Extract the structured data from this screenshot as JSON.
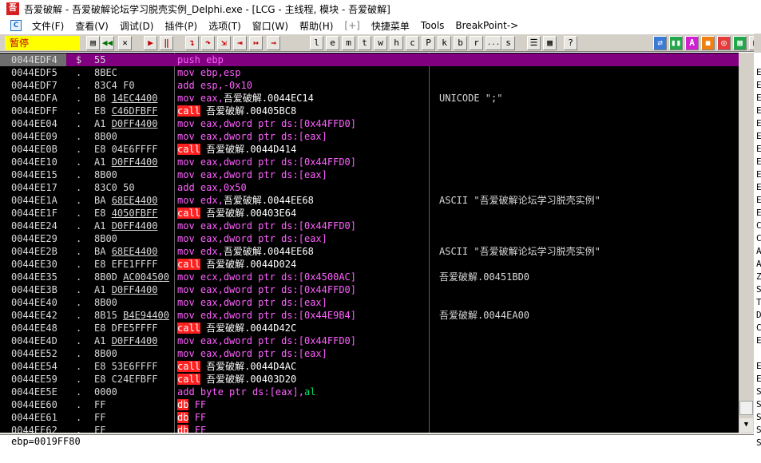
{
  "window": {
    "icon_text": "吾",
    "title": "吾爱破解 - 吾爱破解论坛学习脱壳实例_Delphi.exe - [LCG - 主线程, 模块 - 吾爱破解]"
  },
  "menu": {
    "icon_text": "C",
    "items": [
      "文件(F)",
      "查看(V)",
      "调试(D)",
      "插件(P)",
      "选项(T)",
      "窗口(W)",
      "帮助(H)",
      "[+]",
      "快捷菜单",
      "Tools",
      "BreakPoint->"
    ]
  },
  "toolbar": {
    "status": "暂停",
    "buttons": [
      {
        "label": "▤",
        "icon": "open-icon"
      },
      {
        "label": "◀◀",
        "icon": "rewind-icon"
      },
      {
        "label": "✕",
        "icon": "close-icon"
      },
      {
        "label": "▶",
        "icon": "run-icon"
      },
      {
        "label": "‖",
        "icon": "pause-icon"
      },
      {
        "label": "↴",
        "icon": "step-into-icon"
      },
      {
        "label": "↷",
        "icon": "step-over-icon"
      },
      {
        "label": "⇲",
        "icon": "trace-into-icon"
      },
      {
        "label": "⇥",
        "icon": "trace-over-icon"
      },
      {
        "label": "↦",
        "icon": "execute-till-return-icon"
      },
      {
        "label": "→",
        "icon": "go-to-icon"
      },
      {
        "label": "l",
        "icon": "log-window-letter"
      },
      {
        "label": "e",
        "icon": "executable-modules-letter"
      },
      {
        "label": "m",
        "icon": "memory-map-letter"
      },
      {
        "label": "t",
        "icon": "threads-letter"
      },
      {
        "label": "w",
        "icon": "windows-letter"
      },
      {
        "label": "h",
        "icon": "handles-letter"
      },
      {
        "label": "c",
        "icon": "cpu-letter"
      },
      {
        "label": "P",
        "icon": "patches-letter"
      },
      {
        "label": "k",
        "icon": "call-stack-letter"
      },
      {
        "label": "b",
        "icon": "breakpoints-letter"
      },
      {
        "label": "r",
        "icon": "references-letter"
      },
      {
        "label": "...",
        "icon": "run-trace-letter"
      },
      {
        "label": "s",
        "icon": "source-letter"
      },
      {
        "label": "☰",
        "icon": "list-icon"
      },
      {
        "label": "▦",
        "icon": "grid-icon"
      },
      {
        "label": "?",
        "icon": "help-icon"
      },
      {
        "label": "⇄",
        "icon": "swap-icon"
      },
      {
        "label": "▮▮",
        "icon": "pause-alt-icon"
      },
      {
        "label": "A",
        "icon": "a-icon"
      },
      {
        "label": "◼",
        "icon": "orange-icon"
      },
      {
        "label": "◎",
        "icon": "target-icon"
      },
      {
        "label": "▦",
        "icon": "tile-icon"
      },
      {
        "label": "▤",
        "icon": "doc-icon"
      }
    ]
  },
  "disasm": {
    "rows": [
      {
        "addr": "0044EDF4",
        "mark": "$",
        "hex": "55",
        "hex_u": "",
        "asm": [
          [
            "push",
            "m-push"
          ],
          [
            " ",
            ""
          ],
          [
            "ebp",
            "o-reg"
          ]
        ],
        "cmt": "",
        "selected": true
      },
      {
        "addr": "0044EDF5",
        "mark": ".",
        "hex": "8BEC",
        "hex_u": "",
        "asm": [
          [
            "mov",
            "m-mov"
          ],
          [
            " ",
            ""
          ],
          [
            "ebp,esp",
            "o-reg"
          ]
        ],
        "cmt": ""
      },
      {
        "addr": "0044EDF7",
        "mark": ".",
        "hex": "83C4 F0",
        "hex_u": "",
        "asm": [
          [
            "add",
            "m-add"
          ],
          [
            " ",
            ""
          ],
          [
            "esp,",
            "o-reg"
          ],
          [
            "-0x10",
            "o-num"
          ]
        ],
        "cmt": ""
      },
      {
        "addr": "0044EDFA",
        "mark": ".",
        "hex": "B8 ",
        "hex_u": "14EC4400",
        "asm": [
          [
            "mov",
            "m-mov"
          ],
          [
            " ",
            ""
          ],
          [
            "eax,",
            "o-reg"
          ],
          [
            "吾爱破解.0044EC14",
            "o-txt"
          ]
        ],
        "cmt": "UNICODE \";\""
      },
      {
        "addr": "0044EDFF",
        "mark": ".",
        "hex": "E8 ",
        "hex_u": "C46DFBFF",
        "asm": [
          [
            "call",
            "m-call"
          ],
          [
            " ",
            ""
          ],
          [
            "吾爱破解.00405BC8",
            "o-txt"
          ]
        ],
        "cmt": ""
      },
      {
        "addr": "0044EE04",
        "mark": ".",
        "hex": "A1 ",
        "hex_u": "D0FF4400",
        "asm": [
          [
            "mov",
            "m-mov"
          ],
          [
            " ",
            ""
          ],
          [
            "eax,dword ptr ds:[0x44FFD0]",
            "o-ptr"
          ]
        ],
        "cmt": ""
      },
      {
        "addr": "0044EE09",
        "mark": ".",
        "hex": "8B00",
        "hex_u": "",
        "asm": [
          [
            "mov",
            "m-mov"
          ],
          [
            " ",
            ""
          ],
          [
            "eax,dword ptr ds:[eax]",
            "o-ptr"
          ]
        ],
        "cmt": ""
      },
      {
        "addr": "0044EE0B",
        "mark": ".",
        "hex": "E8 04E6FFFF",
        "hex_u": "",
        "asm": [
          [
            "call",
            "m-call"
          ],
          [
            " ",
            ""
          ],
          [
            "吾爱破解.0044D414",
            "o-txt"
          ]
        ],
        "cmt": ""
      },
      {
        "addr": "0044EE10",
        "mark": ".",
        "hex": "A1 ",
        "hex_u": "D0FF4400",
        "asm": [
          [
            "mov",
            "m-mov"
          ],
          [
            " ",
            ""
          ],
          [
            "eax,dword ptr ds:[0x44FFD0]",
            "o-ptr"
          ]
        ],
        "cmt": ""
      },
      {
        "addr": "0044EE15",
        "mark": ".",
        "hex": "8B00",
        "hex_u": "",
        "asm": [
          [
            "mov",
            "m-mov"
          ],
          [
            " ",
            ""
          ],
          [
            "eax,dword ptr ds:[eax]",
            "o-ptr"
          ]
        ],
        "cmt": ""
      },
      {
        "addr": "0044EE17",
        "mark": ".",
        "hex": "83C0 50",
        "hex_u": "",
        "asm": [
          [
            "add",
            "m-add"
          ],
          [
            " ",
            ""
          ],
          [
            "eax,",
            "o-reg"
          ],
          [
            "0x50",
            "o-num"
          ]
        ],
        "cmt": ""
      },
      {
        "addr": "0044EE1A",
        "mark": ".",
        "hex": "BA ",
        "hex_u": "68EE4400",
        "asm": [
          [
            "mov",
            "m-mov"
          ],
          [
            " ",
            ""
          ],
          [
            "edx,",
            "o-reg"
          ],
          [
            "吾爱破解.0044EE68",
            "o-txt"
          ]
        ],
        "cmt": "ASCII \"吾爱破解论坛学习脱壳实例\""
      },
      {
        "addr": "0044EE1F",
        "mark": ".",
        "hex": "E8 ",
        "hex_u": "4050FBFF",
        "asm": [
          [
            "call",
            "m-call"
          ],
          [
            " ",
            ""
          ],
          [
            "吾爱破解.00403E64",
            "o-txt"
          ]
        ],
        "cmt": ""
      },
      {
        "addr": "0044EE24",
        "mark": ".",
        "hex": "A1 ",
        "hex_u": "D0FF4400",
        "asm": [
          [
            "mov",
            "m-mov"
          ],
          [
            " ",
            ""
          ],
          [
            "eax,dword ptr ds:[0x44FFD0]",
            "o-ptr"
          ]
        ],
        "cmt": ""
      },
      {
        "addr": "0044EE29",
        "mark": ".",
        "hex": "8B00",
        "hex_u": "",
        "asm": [
          [
            "mov",
            "m-mov"
          ],
          [
            " ",
            ""
          ],
          [
            "eax,dword ptr ds:[eax]",
            "o-ptr"
          ]
        ],
        "cmt": ""
      },
      {
        "addr": "0044EE2B",
        "mark": ".",
        "hex": "BA ",
        "hex_u": "68EE4400",
        "asm": [
          [
            "mov",
            "m-mov"
          ],
          [
            " ",
            ""
          ],
          [
            "edx,",
            "o-reg"
          ],
          [
            "吾爱破解.0044EE68",
            "o-txt"
          ]
        ],
        "cmt": "ASCII \"吾爱破解论坛学习脱壳实例\""
      },
      {
        "addr": "0044EE30",
        "mark": ".",
        "hex": "E8 EFE1FFFF",
        "hex_u": "",
        "asm": [
          [
            "call",
            "m-call"
          ],
          [
            " ",
            ""
          ],
          [
            "吾爱破解.0044D024",
            "o-txt"
          ]
        ],
        "cmt": ""
      },
      {
        "addr": "0044EE35",
        "mark": ".",
        "hex": "8B0D ",
        "hex_u": "AC004500",
        "asm": [
          [
            "mov",
            "m-mov"
          ],
          [
            " ",
            ""
          ],
          [
            "ecx,dword ptr ds:[0x4500AC]",
            "o-ptr"
          ]
        ],
        "cmt": "吾爱破解.00451BD0"
      },
      {
        "addr": "0044EE3B",
        "mark": ".",
        "hex": "A1 ",
        "hex_u": "D0FF4400",
        "asm": [
          [
            "mov",
            "m-mov"
          ],
          [
            " ",
            ""
          ],
          [
            "eax,dword ptr ds:[0x44FFD0]",
            "o-ptr"
          ]
        ],
        "cmt": ""
      },
      {
        "addr": "0044EE40",
        "mark": ".",
        "hex": "8B00",
        "hex_u": "",
        "asm": [
          [
            "mov",
            "m-mov"
          ],
          [
            " ",
            ""
          ],
          [
            "eax,dword ptr ds:[eax]",
            "o-ptr"
          ]
        ],
        "cmt": ""
      },
      {
        "addr": "0044EE42",
        "mark": ".",
        "hex": "8B15 ",
        "hex_u": "B4E94400",
        "asm": [
          [
            "mov",
            "m-mov"
          ],
          [
            " ",
            ""
          ],
          [
            "edx,dword ptr ds:[0x44E9B4]",
            "o-ptr"
          ]
        ],
        "cmt": "吾爱破解.0044EA00"
      },
      {
        "addr": "0044EE48",
        "mark": ".",
        "hex": "E8 DFE5FFFF",
        "hex_u": "",
        "asm": [
          [
            "call",
            "m-call"
          ],
          [
            " ",
            ""
          ],
          [
            "吾爱破解.0044D42C",
            "o-txt"
          ]
        ],
        "cmt": ""
      },
      {
        "addr": "0044EE4D",
        "mark": ".",
        "hex": "A1 ",
        "hex_u": "D0FF4400",
        "asm": [
          [
            "mov",
            "m-mov"
          ],
          [
            " ",
            ""
          ],
          [
            "eax,dword ptr ds:[0x44FFD0]",
            "o-ptr"
          ]
        ],
        "cmt": ""
      },
      {
        "addr": "0044EE52",
        "mark": ".",
        "hex": "8B00",
        "hex_u": "",
        "asm": [
          [
            "mov",
            "m-mov"
          ],
          [
            " ",
            ""
          ],
          [
            "eax,dword ptr ds:[eax]",
            "o-ptr"
          ]
        ],
        "cmt": ""
      },
      {
        "addr": "0044EE54",
        "mark": ".",
        "hex": "E8 53E6FFFF",
        "hex_u": "",
        "asm": [
          [
            "call",
            "m-call"
          ],
          [
            " ",
            ""
          ],
          [
            "吾爱破解.0044D4AC",
            "o-txt"
          ]
        ],
        "cmt": ""
      },
      {
        "addr": "0044EE59",
        "mark": ".",
        "hex": "E8 C24EFBFF",
        "hex_u": "",
        "asm": [
          [
            "call",
            "m-call"
          ],
          [
            " ",
            ""
          ],
          [
            "吾爱破解.00403D20",
            "o-txt"
          ]
        ],
        "cmt": ""
      },
      {
        "addr": "0044EE5E",
        "mark": ".",
        "hex": "0000",
        "hex_u": "",
        "asm": [
          [
            "add",
            "m-add"
          ],
          [
            " ",
            ""
          ],
          [
            "byte ptr ds:[eax],",
            "o-ptr"
          ],
          [
            "al",
            "o-al"
          ]
        ],
        "cmt": ""
      },
      {
        "addr": "0044EE60",
        "mark": ".",
        "hex": "FF",
        "hex_u": "",
        "asm": [
          [
            "db",
            "m-db"
          ],
          [
            " ",
            ""
          ],
          [
            "FF",
            "o-reg"
          ]
        ],
        "cmt": ""
      },
      {
        "addr": "0044EE61",
        "mark": ".",
        "hex": "FF",
        "hex_u": "",
        "asm": [
          [
            "db",
            "m-db"
          ],
          [
            " ",
            ""
          ],
          [
            "FF",
            "o-reg"
          ]
        ],
        "cmt": ""
      },
      {
        "addr": "0044EE62",
        "mark": ".",
        "hex": "FF",
        "hex_u": "",
        "asm": [
          [
            "db",
            "m-db"
          ],
          [
            " ",
            ""
          ],
          [
            "FF",
            "o-reg"
          ]
        ],
        "cmt": ""
      }
    ]
  },
  "info": {
    "text": "ebp=0019FF80"
  },
  "right_strip": {
    "letters": [
      "E",
      "E",
      "E",
      "E",
      "E",
      "E",
      "E",
      "E",
      "E",
      "E",
      "E",
      "E",
      "C",
      "C",
      "A",
      "A",
      "Z",
      "S",
      "T",
      "D",
      "C",
      "E",
      "",
      "E",
      "E",
      "S",
      "S",
      "S",
      "S",
      "S"
    ]
  }
}
